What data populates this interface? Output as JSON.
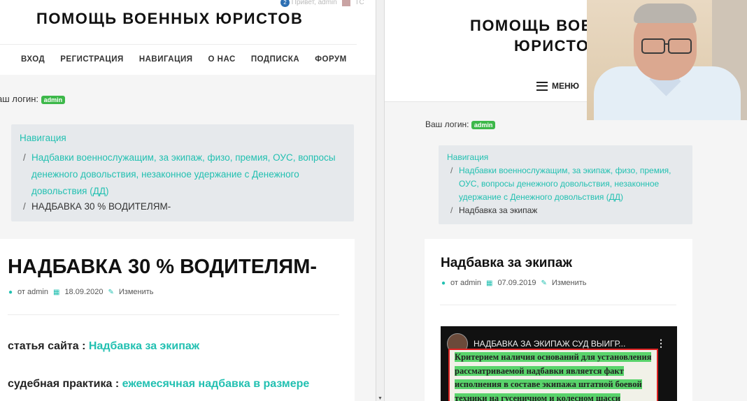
{
  "left": {
    "site_title": "ПОМОЩЬ ВОЕННЫХ ЮРИСТОВ",
    "admin_bar": {
      "badge_count": "2",
      "greeting": "Привет, admin",
      "search_hint": "ТС"
    },
    "nav": [
      "ВХОД",
      "РЕГИСТРАЦИЯ",
      "НАВИГАЦИЯ",
      "О НАС",
      "ПОДПИСКА",
      "ФОРУМ"
    ],
    "login_label": "аш логин:",
    "login_user": "admin",
    "breadcrumb": {
      "root": "Навигация",
      "category": "Надбавки военнослужащим, за экипаж, физо, премия, ОУС, вопросы денежного довольствия, незаконное удержание с Денежного довольствия (ДД)",
      "current": "НАДБАВКА 30 % ВОДИТЕЛЯМ-"
    },
    "article": {
      "title": "НАДБАВКА 30 % ВОДИТЕЛЯМ-",
      "author": "от admin",
      "date": "18.09.2020",
      "edit": "Изменить",
      "para1_label": "статья сайта :",
      "para1_link": "Надбавка за экипаж",
      "para2_label": "судебная практика :",
      "para2_link": "ежемесячная надбавка в размере"
    }
  },
  "right": {
    "site_title_line1": "ПОМОЩЬ ВОЕ",
    "site_title_line2": "ЮРИСТО",
    "menu_label": "МЕНЮ",
    "login_label": "Ваш логин:",
    "login_user": "admin",
    "breadcrumb": {
      "root": "Навигация",
      "category": "Надбавки военнослужащим, за экипаж, физо, премия, ОУС, вопросы денежного довольствия, незаконное удержание с Денежного довольствия (ДД)",
      "current": "Надбавка за экипаж"
    },
    "article": {
      "title": "Надбавка за экипаж",
      "author": "от admin",
      "date": "07.09.2019",
      "edit": "Изменить"
    },
    "video": {
      "title": "НАДБАВКА ЗА ЭКИПАЖ СУД ВЫИГР...",
      "doc_lines": [
        "Критерием наличия оснований для установления",
        "рассматриваемой надбавки является факт",
        "исполнения в составе экипажа штатной боевой",
        "техники на гусеничном и колесном шасси"
      ]
    }
  },
  "colors": {
    "accent": "#22c0b1",
    "tag": "#3db84a",
    "doc_border": "#dd2222",
    "highlight": "#59d36b"
  }
}
